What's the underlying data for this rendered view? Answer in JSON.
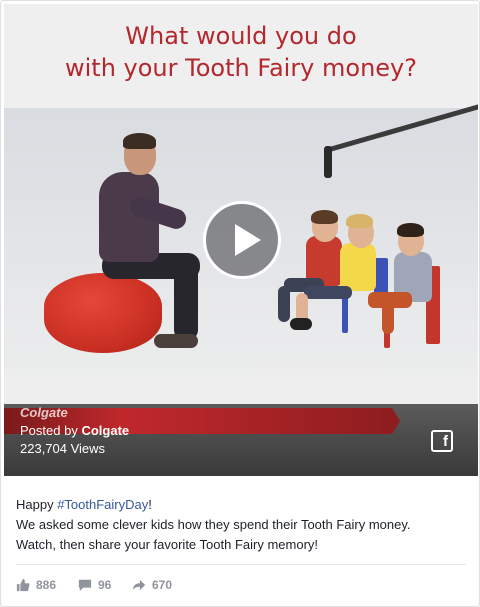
{
  "video": {
    "title_line1": "What would you do",
    "title_line2": "with your Tooth Fairy money?",
    "brand_watermark": "Colgate",
    "posted_prefix": "Posted by",
    "posted_by": "Colgate",
    "views": "223,704 Views",
    "play_icon": "play-icon",
    "share_icon": "facebook-icon",
    "fb_letter": "f"
  },
  "post": {
    "text_prefix": "Happy ",
    "hashtag": "#ToothFairyDay",
    "text_suffix": "!",
    "line2": "We asked some clever kids how they spend their Tooth Fairy money.",
    "line3": "Watch, then share your favorite Tooth Fairy memory!"
  },
  "actions": {
    "likes": "886",
    "comments": "96",
    "shares": "670",
    "like_icon": "thumbs-up-icon",
    "comment_icon": "comment-icon",
    "share_icon": "share-arrow-icon"
  },
  "colors": {
    "title_red": "#b3282f",
    "brand_red": "#c0282c",
    "link_blue": "#365899",
    "meta_gray": "#90949c"
  }
}
